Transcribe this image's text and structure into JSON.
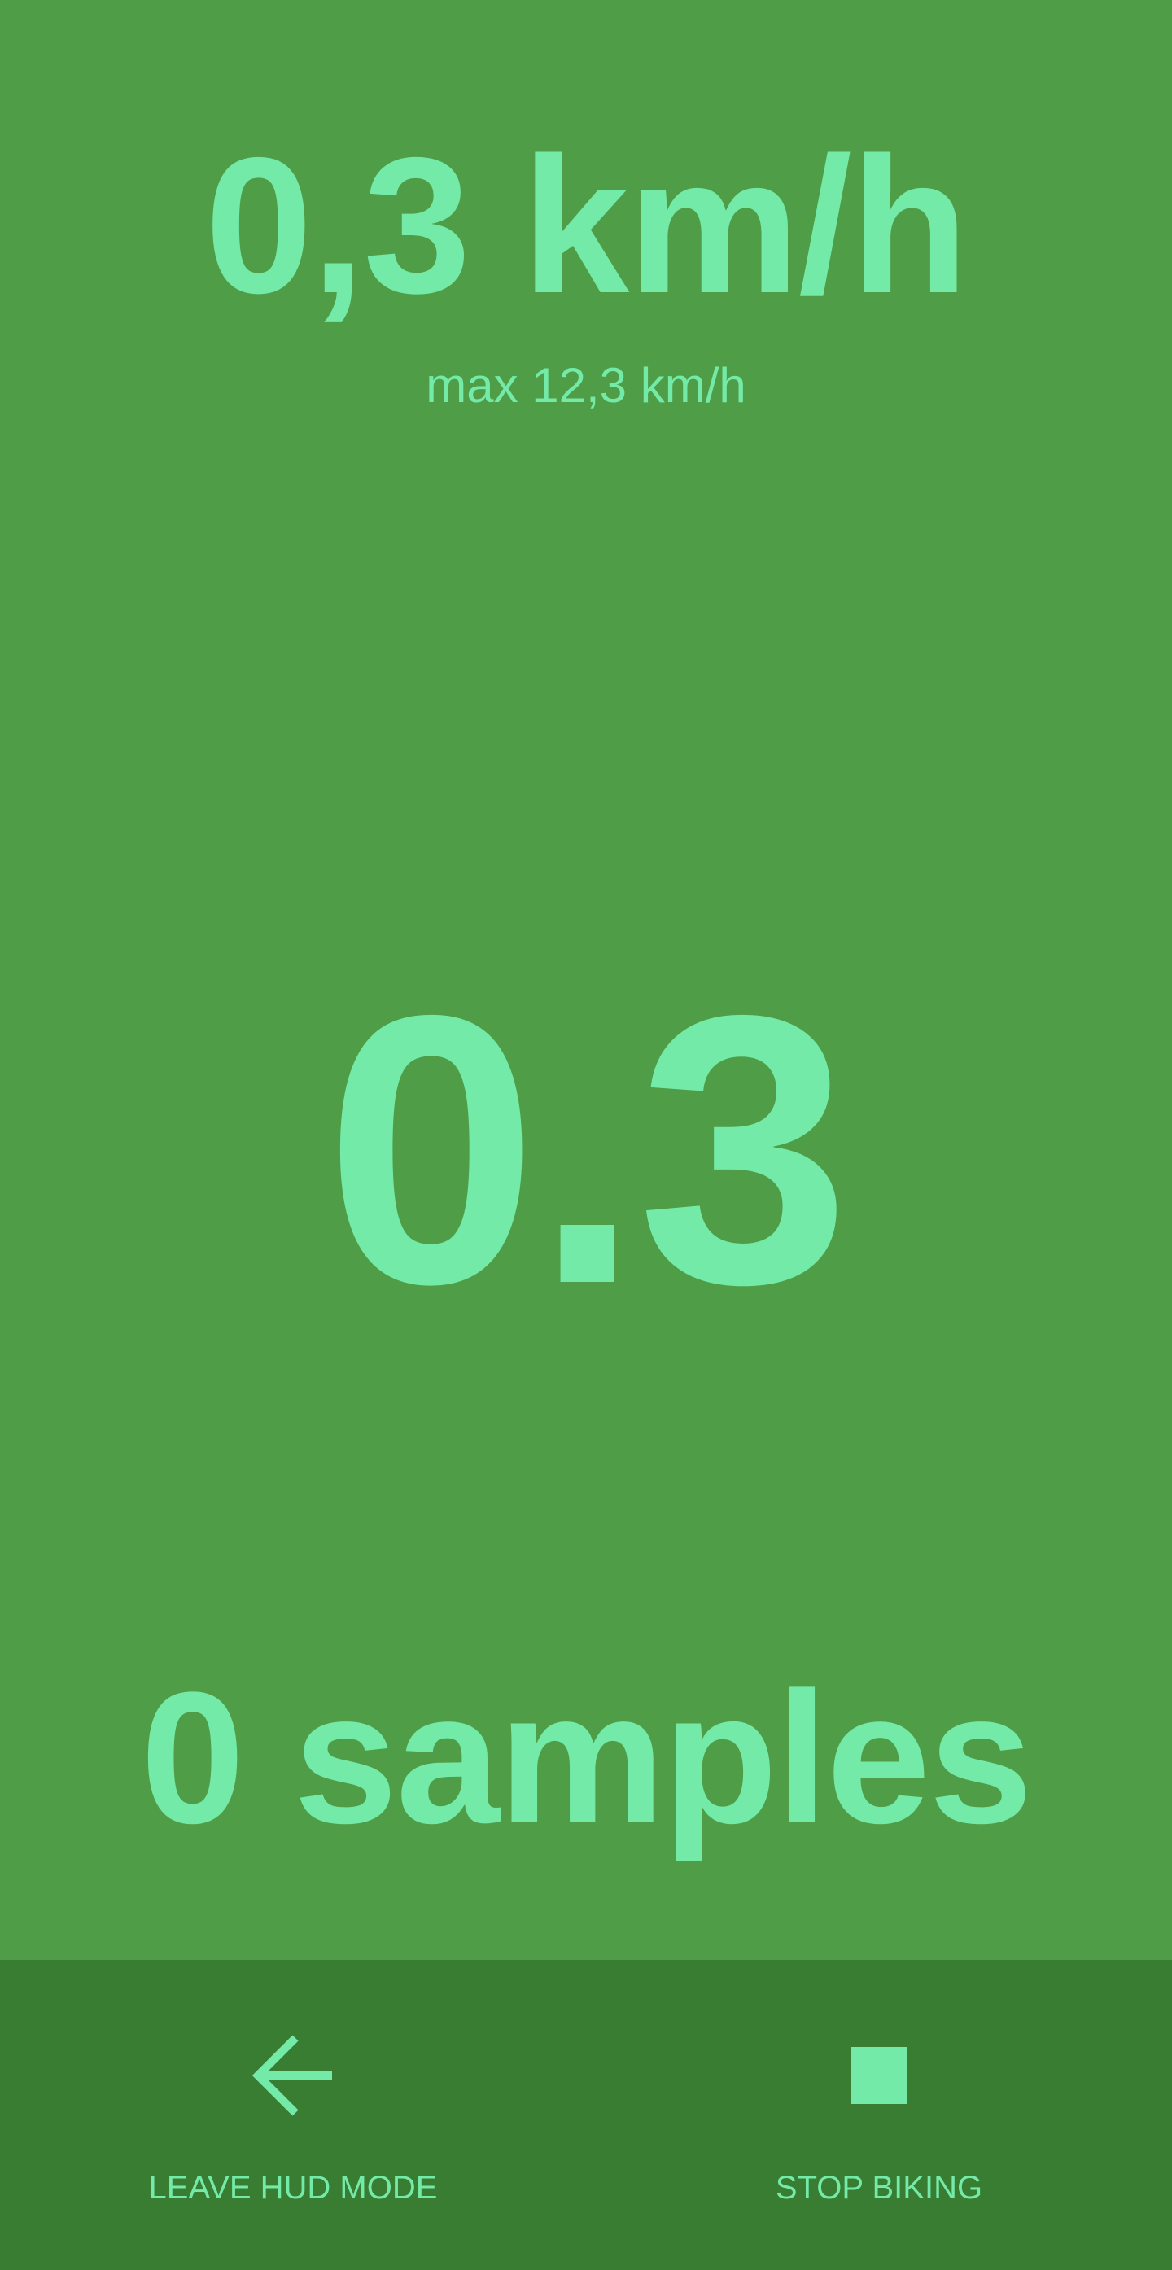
{
  "hud": {
    "speed": "0,3 km/h",
    "max_speed": "max 12,3 km/h",
    "big_value": "0.3",
    "samples": "0 samples"
  },
  "actions": {
    "leave": {
      "label": "LEAVE HUD MODE",
      "icon": "arrow-left-icon"
    },
    "stop": {
      "label": "STOP BIKING",
      "icon": "stop-icon"
    }
  },
  "colors": {
    "background": "#4f9e47",
    "bottom_bar": "#397d33",
    "accent": "#74eaa9"
  }
}
